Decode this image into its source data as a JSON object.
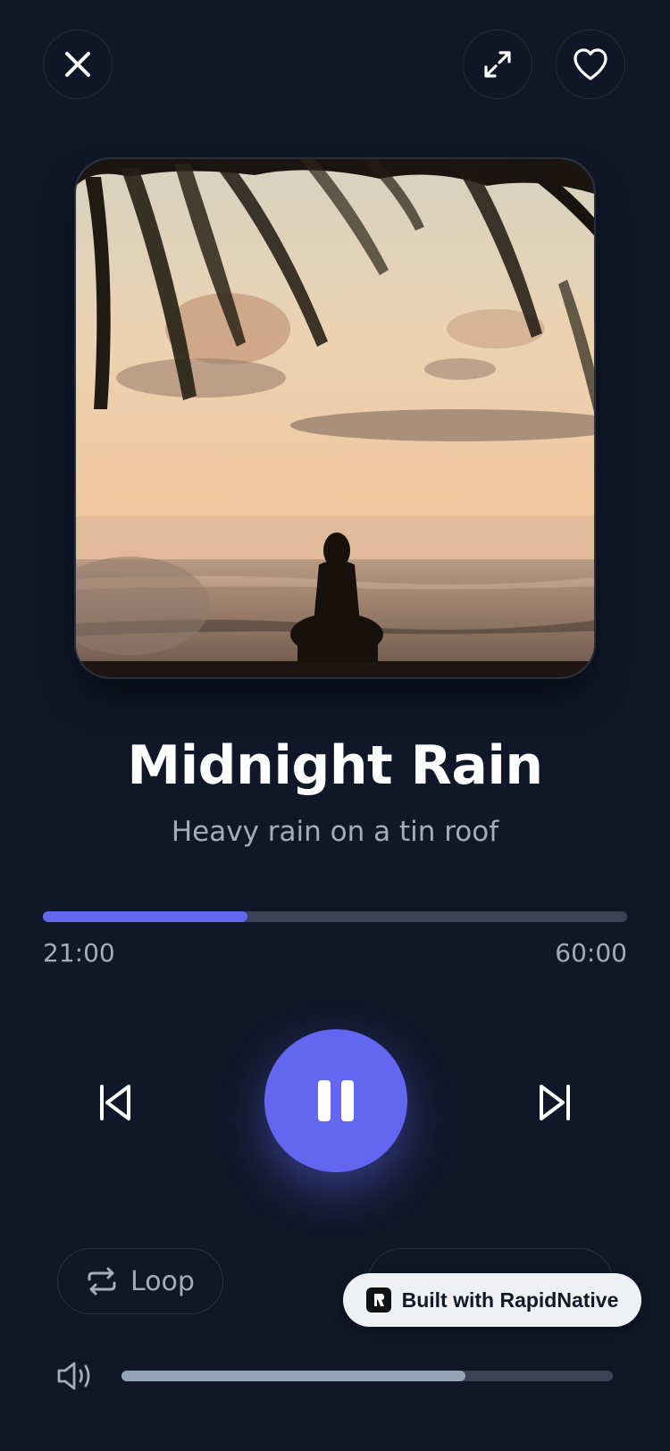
{
  "header": {
    "close_icon": "close-icon",
    "expand_icon": "expand-icon",
    "favorite_icon": "heart-icon"
  },
  "track": {
    "title": "Midnight Rain",
    "subtitle": "Heavy rain on a tin roof"
  },
  "progress": {
    "current": "21:00",
    "total": "60:00",
    "fraction": 0.35
  },
  "controls": {
    "previous_icon": "skip-previous-icon",
    "pause_icon": "pause-icon",
    "next_icon": "skip-next-icon"
  },
  "options": {
    "loop_label": "Loop",
    "loop_icon": "repeat-icon"
  },
  "badge": {
    "label": "Built with RapidNative"
  },
  "volume": {
    "icon": "volume-icon",
    "fraction": 0.7
  },
  "colors": {
    "background": "#101729",
    "accent": "#6366f1",
    "muted_text": "#a3acbd",
    "track": "#3b4356"
  }
}
